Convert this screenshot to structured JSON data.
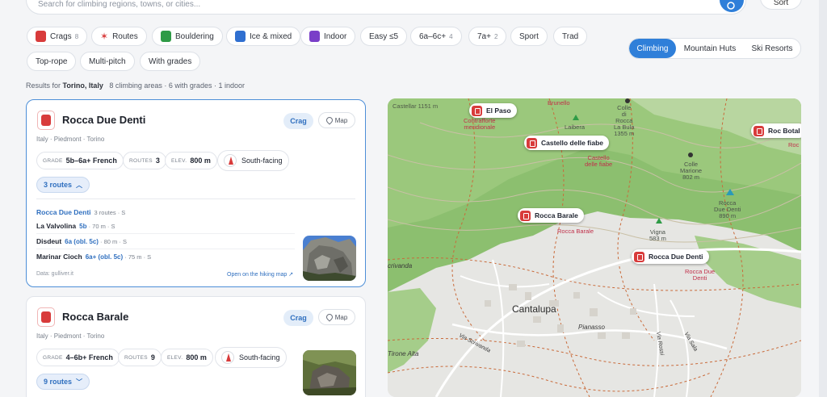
{
  "search": {
    "placeholder": "Search for climbing regions, towns, or cities...",
    "sort_label": "Sort"
  },
  "filters": [
    {
      "label": "Crags",
      "count": "8",
      "icon": "crag-icon"
    },
    {
      "label": "Routes",
      "count": "",
      "icon": "climber-icon"
    },
    {
      "label": "Bouldering",
      "count": "",
      "icon": "boulder-icon"
    },
    {
      "label": "Ice & mixed",
      "count": "",
      "icon": "ice-icon"
    },
    {
      "label": "Indoor",
      "count": "",
      "icon": "indoor-icon"
    },
    {
      "label": "Easy ≤5",
      "count": ""
    },
    {
      "label": "6a–6c+",
      "count": "4"
    },
    {
      "label": "7a+",
      "count": "2"
    },
    {
      "label": "Sport",
      "count": ""
    },
    {
      "label": "Trad",
      "count": ""
    },
    {
      "label": "Top-rope",
      "count": ""
    },
    {
      "label": "Multi-pitch",
      "count": ""
    },
    {
      "label": "With grades",
      "count": ""
    }
  ],
  "segments": [
    "Climbing",
    "Mountain Huts",
    "Ski Resorts"
  ],
  "results": {
    "prefix": "Results for",
    "place": "Torino, Italy",
    "summary": "8 climbing areas · 6 with grades · 1 indoor"
  },
  "cards": [
    {
      "title": "Rocca Due Denti",
      "location": "Italy · Piedmont · Torino",
      "type_badge": "Crag",
      "map_label": "Map",
      "grade_key": "GRADE",
      "grade": "5b–6a+ French",
      "routes_key": "ROUTES",
      "routes": "3",
      "elev_key": "ELEV.",
      "elev": "800 m",
      "aspect": "South-facing",
      "routes_toggle": "3 routes",
      "sector": {
        "name": "Rocca Due Denti",
        "meta": "3 routes · S"
      },
      "route_list": [
        {
          "name": "La Valvolina",
          "grade": "5b",
          "meta": " · 70 m · S"
        },
        {
          "name": "Disdeut",
          "grade": "6a (obl. 5c)",
          "meta": " · 80 m · S"
        },
        {
          "name": "Marinar Cioch",
          "grade": "6a+ (obl. 5c)",
          "meta": " · 75 m · S"
        }
      ],
      "data_source": "Data: gulliver.it",
      "hiking_link": "Open on the hiking map ↗"
    },
    {
      "title": "Rocca Barale",
      "location": "Italy · Piedmont · Torino",
      "type_badge": "Crag",
      "map_label": "Map",
      "grade_key": "GRADE",
      "grade": "4–6b+ French",
      "routes_key": "ROUTES",
      "routes": "9",
      "elev_key": "ELEV.",
      "elev": "800 m",
      "aspect": "South-facing",
      "routes_toggle": "9 routes"
    }
  ],
  "map": {
    "markers": [
      "El Paso",
      "Castello delle fiabe",
      "Roc Botal",
      "Rocca Barale",
      "Rocca Due Denti"
    ],
    "labels": {
      "castellar": "Castellar\n1151 m",
      "contrafforte": "Contrafforte\nmeridionale",
      "brunello": "Brunello",
      "brunello2": "Laibera",
      "colle": "Colle\ndi\nRocca\nLa Bula\n1355 m",
      "castello_red": "Castello\ndelle fiabe",
      "colle_marione": "Colle\nMarione\n802 m",
      "rocca_due_green": "Rocca\nDue Denti\n890 m",
      "rocca_barale_red": "Rocca Barale",
      "vigna": "Vigna\n583 m",
      "rocca_due_red": "Rocca Due\nDenti",
      "cantalupa": "Cantalupa",
      "crivanda": "crivanda",
      "pianasso": "Pianasso",
      "via_scrivanda": "Via Scrivanda",
      "via_rossi": "Via Rossi",
      "via_sala": "Via Sala",
      "tirone": "Tirone Alta",
      "rocbotal_red": "Roc"
    }
  }
}
